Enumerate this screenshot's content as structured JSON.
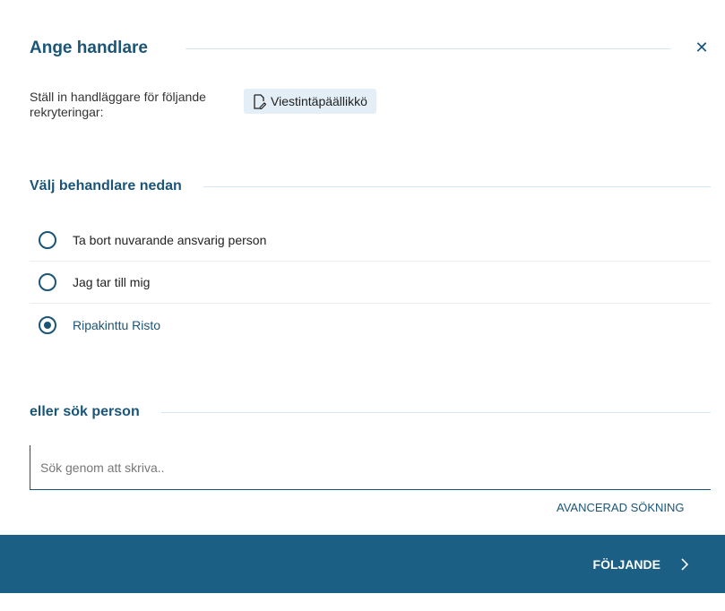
{
  "dialog": {
    "title": "Ange handlare",
    "close_icon": "close-icon"
  },
  "assign": {
    "label": "Ställ in handläggare för följande rekryteringar:",
    "chip_label": "Viestintäpäällikkö",
    "chip_icon": "document-edit-icon"
  },
  "handler_section": {
    "title": "Välj behandlare nedan",
    "options": [
      {
        "label": "Ta bort nuvarande ansvarig person",
        "selected": false
      },
      {
        "label": "Jag tar till mig",
        "selected": false
      },
      {
        "label": "Ripakinttu Risto",
        "selected": true
      }
    ]
  },
  "search_section": {
    "title": "eller sök person",
    "placeholder": "Sök genom att skriva..",
    "value": "",
    "advanced_label": "AVANCERAD SÖKNING"
  },
  "footer": {
    "next_label": "FÖLJANDE",
    "next_icon": "chevron-right-icon"
  },
  "colors": {
    "accent": "#1a5578",
    "footer_bg": "#1c5f85",
    "chip_bg": "#e3eef6"
  }
}
